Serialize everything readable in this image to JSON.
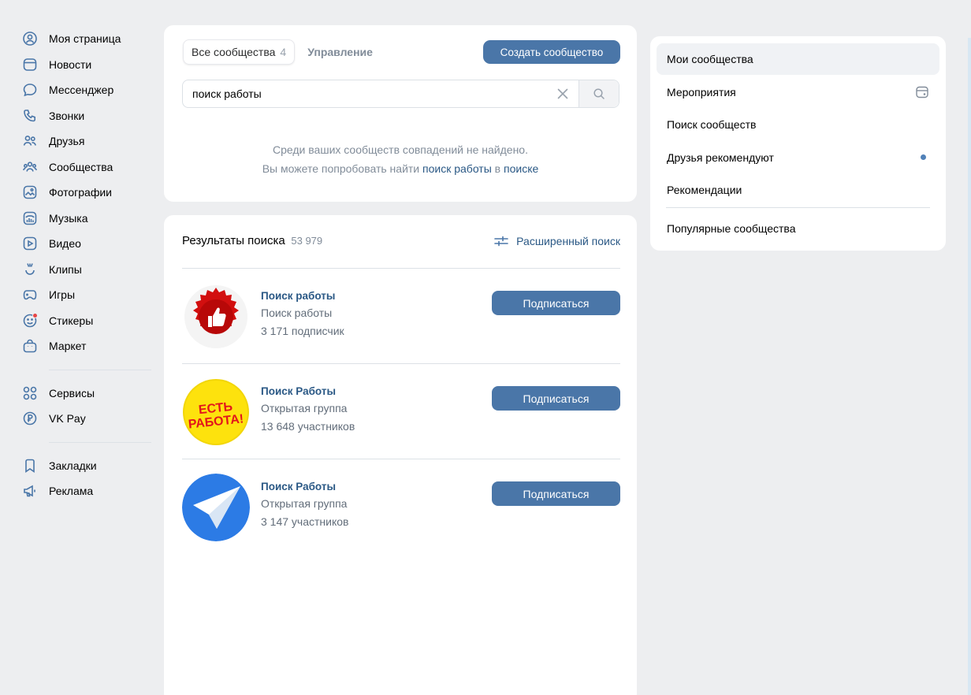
{
  "nav": {
    "items": [
      {
        "label": "Моя страница",
        "icon": "profile-icon"
      },
      {
        "label": "Новости",
        "icon": "news-icon"
      },
      {
        "label": "Мессенджер",
        "icon": "messenger-icon"
      },
      {
        "label": "Звонки",
        "icon": "phone-icon"
      },
      {
        "label": "Друзья",
        "icon": "friends-icon"
      },
      {
        "label": "Сообщества",
        "icon": "communities-icon"
      },
      {
        "label": "Фотографии",
        "icon": "photos-icon"
      },
      {
        "label": "Музыка",
        "icon": "music-icon"
      },
      {
        "label": "Видео",
        "icon": "video-icon"
      },
      {
        "label": "Клипы",
        "icon": "clips-icon"
      },
      {
        "label": "Игры",
        "icon": "games-icon"
      },
      {
        "label": "Стикеры",
        "icon": "stickers-icon"
      },
      {
        "label": "Маркет",
        "icon": "market-icon"
      }
    ],
    "items2": [
      {
        "label": "Сервисы",
        "icon": "services-icon"
      },
      {
        "label": "VK Pay",
        "icon": "vkpay-icon"
      }
    ],
    "items3": [
      {
        "label": "Закладки",
        "icon": "bookmark-icon"
      },
      {
        "label": "Реклама",
        "icon": "ads-icon"
      }
    ]
  },
  "top": {
    "tab_all": "Все сообщества",
    "tab_all_count": "4",
    "tab_manage": "Управление",
    "create_label": "Создать сообщество",
    "search_value": "поиск работы",
    "empty_line1": "Среди ваших сообществ совпадений не найдено.",
    "empty_line2_pre": "Вы можете попробовать найти ",
    "empty_line2_query": "поиск работы",
    "empty_line2_mid": " в ",
    "empty_line2_link": "поиске"
  },
  "results": {
    "title": "Результаты поиска",
    "count": "53 979",
    "advanced_label": "Расширенный поиск",
    "items": [
      {
        "name": "Поиск работы",
        "type": "Поиск работы",
        "members": "3 171 подписчик",
        "button": "Подписаться"
      },
      {
        "name": "Поиск Работы",
        "type": "Открытая группа",
        "members": "13 648 участников",
        "button": "Подписаться"
      },
      {
        "name": "Поиск Работы",
        "type": "Открытая группа",
        "members": "3 147 участников",
        "button": "Подписаться"
      }
    ],
    "avatar2_text1": "ЕСТЬ",
    "avatar2_text2": "РАБОТА!"
  },
  "right_menu": {
    "items": [
      "Мои сообщества",
      "Мероприятия",
      "Поиск сообществ",
      "Друзья рекомендуют",
      "Рекомендации",
      "Популярные сообщества"
    ]
  },
  "colors": {
    "accent": "#4a76a8",
    "link": "#2a5885",
    "background": "#edeef0",
    "icon": "#4a76a8"
  }
}
